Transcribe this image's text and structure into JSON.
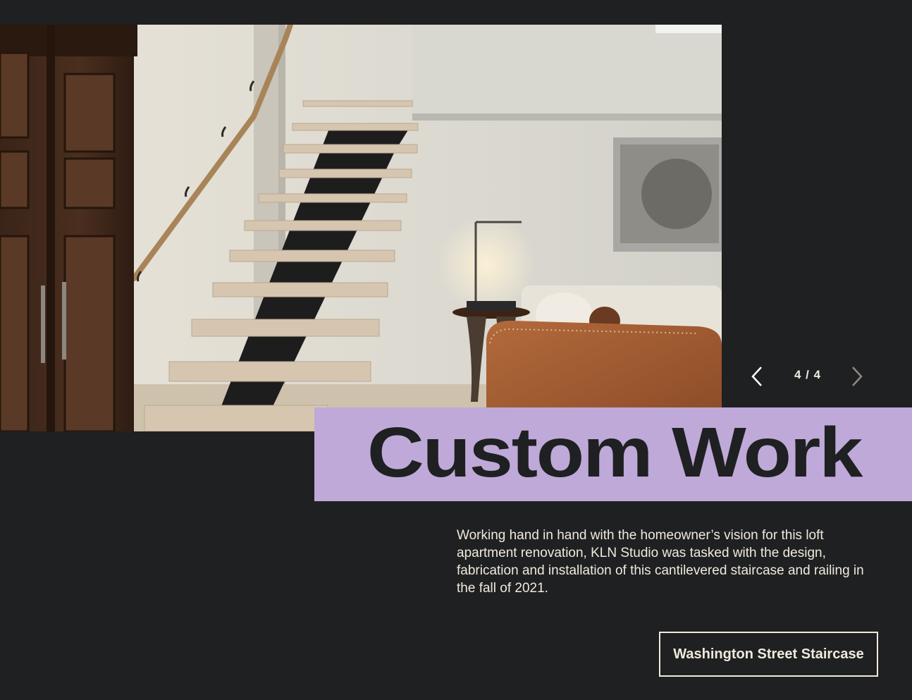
{
  "slideshow": {
    "counter": "4 / 4",
    "prev_icon": "chevron-left-icon",
    "next_icon": "chevron-right-icon"
  },
  "hero": {
    "title": "Custom Work",
    "band_color": "#bfa9d8"
  },
  "description": "Working hand in hand with the homeowner’s vision for this loft apartment renovation, KLN Studio was tasked with the design, fabrication and installation of this cantilevered staircase and railing in the fall of 2021.",
  "project_button": {
    "label": "Washington Street Staircase"
  },
  "colors": {
    "background": "#1f2022",
    "text": "#efeadd",
    "accent": "#bfa9d8"
  }
}
